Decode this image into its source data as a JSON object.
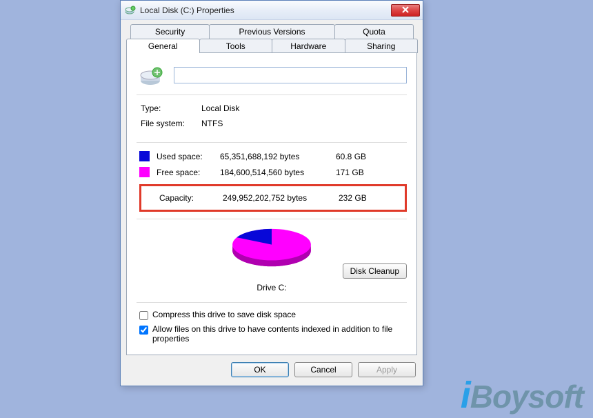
{
  "window": {
    "title": "Local Disk (C:) Properties",
    "close_tooltip": "Close"
  },
  "tabs": {
    "row1": [
      "Security",
      "Previous Versions",
      "Quota"
    ],
    "row2": [
      "General",
      "Tools",
      "Hardware",
      "Sharing"
    ],
    "active": "General"
  },
  "general": {
    "name_value": "",
    "type_label": "Type:",
    "type_value": "Local Disk",
    "fs_label": "File system:",
    "fs_value": "NTFS",
    "used_label": "Used space:",
    "used_bytes": "65,351,688,192 bytes",
    "used_hr": "60.8 GB",
    "free_label": "Free space:",
    "free_bytes": "184,600,514,560 bytes",
    "free_hr": "171 GB",
    "capacity_label": "Capacity:",
    "capacity_bytes": "249,952,202,752 bytes",
    "capacity_hr": "232 GB",
    "drive_caption": "Drive C:",
    "cleanup_label": "Disk Cleanup",
    "compress_label": "Compress this drive to save disk space",
    "compress_checked": false,
    "index_label": "Allow files on this drive to have contents indexed in addition to file properties",
    "index_checked": true
  },
  "buttons": {
    "ok": "OK",
    "cancel": "Cancel",
    "apply": "Apply"
  },
  "chart_data": {
    "type": "pie",
    "title": "Drive C:",
    "series": [
      {
        "name": "Used space",
        "value": 65351688192,
        "color": "#0808d8"
      },
      {
        "name": "Free space",
        "value": 184600514560,
        "color": "#ff00ff"
      }
    ]
  },
  "watermark": "iBoysoft"
}
